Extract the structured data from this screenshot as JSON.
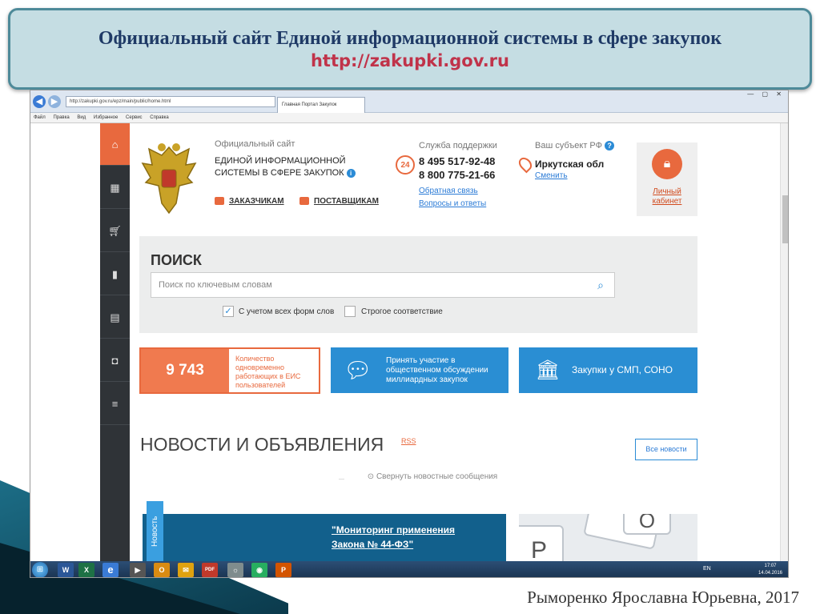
{
  "slide": {
    "title": "Официальный сайт Единой информационной системы в сфере закупок",
    "url": "http://zakupki.gov.ru",
    "author": "Рыморенко Ярославна Юрьевна, 2017"
  },
  "browser": {
    "address": "http://zakupki.gov.ru/epz/main/public/home.html",
    "tab_title": "Главная Портал Закупок",
    "menu": [
      "Файл",
      "Правка",
      "Вид",
      "Избранное",
      "Сервис",
      "Справка"
    ]
  },
  "sidebar": {
    "icons": [
      "home-icon",
      "calendar-icon",
      "cart-icon",
      "book-icon",
      "document-icon",
      "briefcase-icon",
      "list-icon"
    ]
  },
  "header": {
    "official_label": "Официальный сайт",
    "org_line1": "ЕДИНОЙ ИНФОРМАЦИОННОЙ",
    "org_line2": "СИСТЕМЫ В СФЕРЕ ЗАКУПОК",
    "customers_link": "ЗАКАЗЧИКАМ",
    "suppliers_link": "ПОСТАВЩИКАМ",
    "support_label": "Служба поддержки",
    "support_badge": "24",
    "phone1": "8 495 517-92-48",
    "phone2": "8 800 775-21-66",
    "feedback_link": "Обратная связь",
    "faq_link": "Вопросы и ответы",
    "region_label": "Ваш субъект РФ",
    "region_name": "Иркутская обл",
    "region_change": "Сменить",
    "cabinet_line1": "Личный",
    "cabinet_line2": "кабинет"
  },
  "search": {
    "title": "ПОИСК",
    "placeholder": "Поиск по ключевым словам",
    "option1": "С учетом всех форм слов",
    "option1_checked": true,
    "option2": "Строгое соответствие",
    "option2_checked": false
  },
  "cards": {
    "users_count": "9 743",
    "users_label": "Количество одновременно работающих в ЕИС пользователей",
    "discuss_label": "Принять участие в общественном обсуждении миллиардных закупок",
    "smp_label": "Закупки у СМП, СОНО"
  },
  "news": {
    "title": "НОВОСТИ И ОБЪЯВЛЕНИЯ",
    "rss": "RSS",
    "all_news": "Все новости",
    "collapse": "Свернуть новостные сообщения",
    "vertical_label": "Новость",
    "headline_line1": "\"Мониторинг применения",
    "headline_line2": "Закона № 44-ФЗ\""
  },
  "taskbar": {
    "lang": "EN",
    "time": "17:07",
    "date": "14.04.2016",
    "apps": [
      "W",
      "X",
      "e",
      "▶",
      "O",
      "✉",
      "PDF",
      "☼",
      "◉",
      "P"
    ]
  },
  "colors": {
    "accent_orange": "#e8693e",
    "accent_blue": "#2a8ed3",
    "sidebar_dark": "#2f3337",
    "title_blue": "#1f3a66",
    "url_red": "#c0334a"
  }
}
